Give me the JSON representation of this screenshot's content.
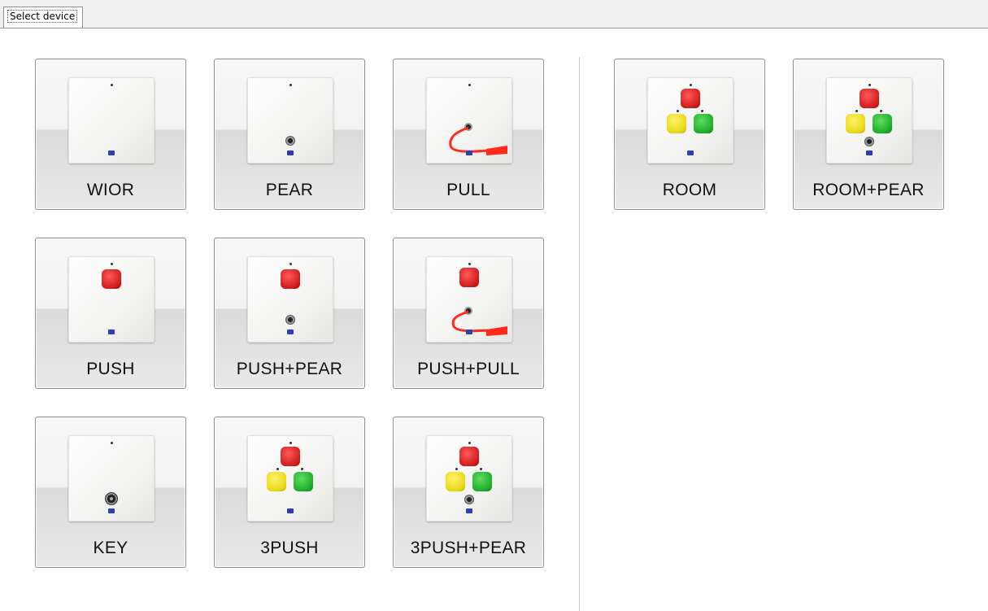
{
  "tab": {
    "label": "Select device"
  },
  "devices": {
    "wior": "WIOR",
    "pear": "PEAR",
    "pull": "PULL",
    "push": "PUSH",
    "push_pear": "PUSH+PEAR",
    "push_pull": "PUSH+PULL",
    "key": "KEY",
    "three_push": "3PUSH",
    "three_push_pear": "3PUSH+PEAR",
    "room": "ROOM",
    "room_pear": "ROOM+PEAR"
  },
  "colors": {
    "red_button": "#d01c1c",
    "yellow_button": "#e8d81a",
    "green_button": "#1fae2c",
    "logo": "#2a3fb8",
    "cord": "#ff2a1a"
  }
}
